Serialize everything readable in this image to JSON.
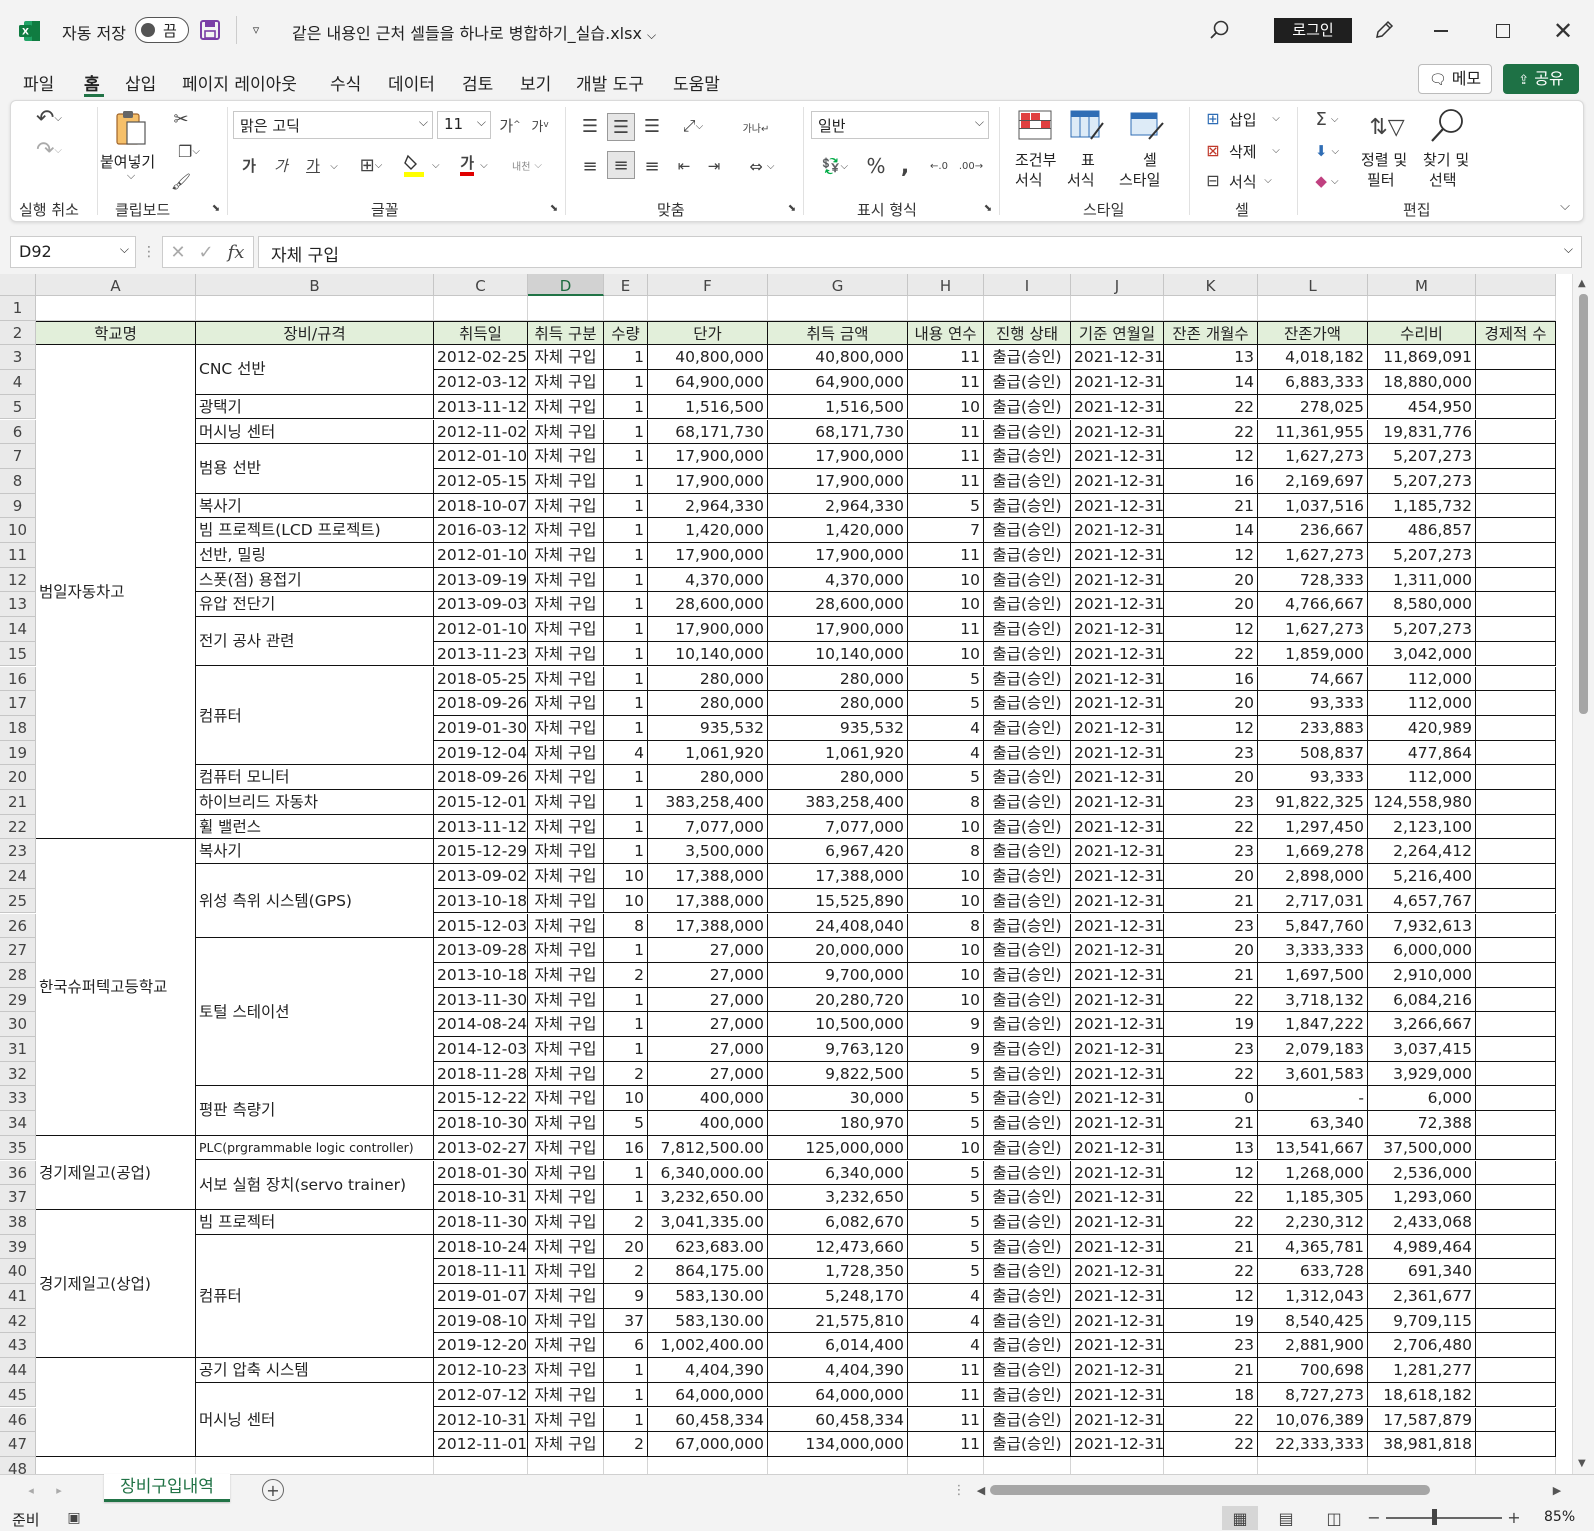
{
  "titlebar": {
    "autosave_label": "자동 저장",
    "autosave_state": "끔",
    "filename": "같은 내용인 근처 셀들을 하나로 병합하기_실습.xlsx",
    "login_label": "로그인",
    "minimize_icon": "minimize-icon",
    "maximize_icon": "maximize-icon",
    "close_icon": "close-icon"
  },
  "menu": {
    "items": [
      "파일",
      "홈",
      "삽입",
      "페이지 레이아웃",
      "수식",
      "데이터",
      "검토",
      "보기",
      "개발 도구",
      "도움말"
    ],
    "active": "홈",
    "memo_label": "메모",
    "share_label": "공유"
  },
  "ribbon": {
    "groups": {
      "undo": "실행 취소",
      "clipboard": "클립보드",
      "font": "글꼴",
      "align": "맞춤",
      "number": "표시 형식",
      "style": "스타일",
      "cells": "셀",
      "edit": "편집"
    },
    "paste_label": "붙여넣기",
    "font_name": "맑은 고딕",
    "font_size": "11",
    "number_format": "일반",
    "conditional_format": [
      "조건부",
      "서식"
    ],
    "table_format": [
      "표",
      "서식"
    ],
    "cell_style": [
      "셀",
      "스타일"
    ],
    "insert": "삽입",
    "delete": "삭제",
    "format": "서식",
    "sort_filter": [
      "정렬 및",
      "필터"
    ],
    "find_select": [
      "찾기 및",
      "선택"
    ],
    "wrap_text": "자동 줄 바꿈",
    "bold": "가",
    "italic": "가",
    "underline": "가",
    "font_color_glyph": "가"
  },
  "formula_bar": {
    "name_box": "D92",
    "fx": "fx",
    "value": "자체 구입"
  },
  "columns": [
    "A",
    "B",
    "C",
    "D",
    "E",
    "F",
    "G",
    "H",
    "I",
    "J",
    "K",
    "L",
    "M"
  ],
  "header_row": [
    "학교명",
    "장비/규격",
    "취득일",
    "취득 구분",
    "수량",
    "단가",
    "취득 금액",
    "내용 연수",
    "진행 상태",
    "기준 연월일",
    "잔존 개월수",
    "잔존가액",
    "수리비",
    "경제적 수"
  ],
  "merged_a": [
    {
      "text": "범일자동차고",
      "from": 3,
      "to": 22
    },
    {
      "text": "한국슈퍼텍고등학교",
      "from": 23,
      "to": 34
    },
    {
      "text": "경기제일고(공업)",
      "from": 35,
      "to": 37
    },
    {
      "text": "경기제일고(상업)",
      "from": 38,
      "to": 43
    },
    {
      "text": "",
      "from": 44,
      "to": 47
    }
  ],
  "merged_b": [
    {
      "text": "CNC 선반",
      "from": 3,
      "to": 4
    },
    {
      "text": "광택기",
      "from": 5,
      "to": 5
    },
    {
      "text": "머시닝 센터",
      "from": 6,
      "to": 6
    },
    {
      "text": "범용 선반",
      "from": 7,
      "to": 8
    },
    {
      "text": "복사기",
      "from": 9,
      "to": 9
    },
    {
      "text": "빔 프로젝트(LCD 프로젝트)",
      "from": 10,
      "to": 10
    },
    {
      "text": "선반, 밀링",
      "from": 11,
      "to": 11
    },
    {
      "text": "스폿(점) 용접기",
      "from": 12,
      "to": 12
    },
    {
      "text": "유압 전단기",
      "from": 13,
      "to": 13
    },
    {
      "text": "전기 공사 관련",
      "from": 14,
      "to": 15
    },
    {
      "text": "컴퓨터",
      "from": 16,
      "to": 19
    },
    {
      "text": "컴퓨터 모니터",
      "from": 20,
      "to": 20
    },
    {
      "text": "하이브리드 자동차",
      "from": 21,
      "to": 21
    },
    {
      "text": "휠 밸런스",
      "from": 22,
      "to": 22
    },
    {
      "text": "복사기",
      "from": 23,
      "to": 23
    },
    {
      "text": "위성 측위 시스템(GPS)",
      "from": 24,
      "to": 26
    },
    {
      "text": "토털 스테이션",
      "from": 27,
      "to": 32
    },
    {
      "text": "평판 측량기",
      "from": 33,
      "to": 34
    },
    {
      "text": "PLC(prgrammable logic controller)",
      "from": 35,
      "to": 35
    },
    {
      "text": "서보 실험 장치(servo trainer)",
      "from": 36,
      "to": 37
    },
    {
      "text": "빔 프로젝터",
      "from": 38,
      "to": 38
    },
    {
      "text": "컴퓨터",
      "from": 39,
      "to": 43
    },
    {
      "text": "공기 압축 시스템",
      "from": 44,
      "to": 44
    },
    {
      "text": "머시닝 센터",
      "from": 45,
      "to": 47
    }
  ],
  "rows": [
    [
      "2012-02-25",
      "자체 구입",
      "1",
      "40,800,000",
      "40,800,000",
      "11",
      "출급(승인)",
      "2021-12-31",
      "13",
      "4,018,182",
      "11,869,091"
    ],
    [
      "2012-03-12",
      "자체 구입",
      "1",
      "64,900,000",
      "64,900,000",
      "11",
      "출급(승인)",
      "2021-12-31",
      "14",
      "6,883,333",
      "18,880,000"
    ],
    [
      "2013-11-12",
      "자체 구입",
      "1",
      "1,516,500",
      "1,516,500",
      "10",
      "출급(승인)",
      "2021-12-31",
      "22",
      "278,025",
      "454,950"
    ],
    [
      "2012-11-02",
      "자체 구입",
      "1",
      "68,171,730",
      "68,171,730",
      "11",
      "출급(승인)",
      "2021-12-31",
      "22",
      "11,361,955",
      "19,831,776"
    ],
    [
      "2012-01-10",
      "자체 구입",
      "1",
      "17,900,000",
      "17,900,000",
      "11",
      "출급(승인)",
      "2021-12-31",
      "12",
      "1,627,273",
      "5,207,273"
    ],
    [
      "2012-05-15",
      "자체 구입",
      "1",
      "17,900,000",
      "17,900,000",
      "11",
      "출급(승인)",
      "2021-12-31",
      "16",
      "2,169,697",
      "5,207,273"
    ],
    [
      "2018-10-07",
      "자체 구입",
      "1",
      "2,964,330",
      "2,964,330",
      "5",
      "출급(승인)",
      "2021-12-31",
      "21",
      "1,037,516",
      "1,185,732"
    ],
    [
      "2016-03-12",
      "자체 구입",
      "1",
      "1,420,000",
      "1,420,000",
      "7",
      "출급(승인)",
      "2021-12-31",
      "14",
      "236,667",
      "486,857"
    ],
    [
      "2012-01-10",
      "자체 구입",
      "1",
      "17,900,000",
      "17,900,000",
      "11",
      "출급(승인)",
      "2021-12-31",
      "12",
      "1,627,273",
      "5,207,273"
    ],
    [
      "2013-09-19",
      "자체 구입",
      "1",
      "4,370,000",
      "4,370,000",
      "10",
      "출급(승인)",
      "2021-12-31",
      "20",
      "728,333",
      "1,311,000"
    ],
    [
      "2013-09-03",
      "자체 구입",
      "1",
      "28,600,000",
      "28,600,000",
      "10",
      "출급(승인)",
      "2021-12-31",
      "20",
      "4,766,667",
      "8,580,000"
    ],
    [
      "2012-01-10",
      "자체 구입",
      "1",
      "17,900,000",
      "17,900,000",
      "11",
      "출급(승인)",
      "2021-12-31",
      "12",
      "1,627,273",
      "5,207,273"
    ],
    [
      "2013-11-23",
      "자체 구입",
      "1",
      "10,140,000",
      "10,140,000",
      "10",
      "출급(승인)",
      "2021-12-31",
      "22",
      "1,859,000",
      "3,042,000"
    ],
    [
      "2018-05-25",
      "자체 구입",
      "1",
      "280,000",
      "280,000",
      "5",
      "출급(승인)",
      "2021-12-31",
      "16",
      "74,667",
      "112,000"
    ],
    [
      "2018-09-26",
      "자체 구입",
      "1",
      "280,000",
      "280,000",
      "5",
      "출급(승인)",
      "2021-12-31",
      "20",
      "93,333",
      "112,000"
    ],
    [
      "2019-01-30",
      "자체 구입",
      "1",
      "935,532",
      "935,532",
      "4",
      "출급(승인)",
      "2021-12-31",
      "12",
      "233,883",
      "420,989"
    ],
    [
      "2019-12-04",
      "자체  구입",
      "4",
      "1,061,920",
      "1,061,920",
      "4",
      "출급(승인)",
      "2021-12-31",
      "23",
      "508,837",
      "477,864"
    ],
    [
      "2018-09-26",
      "자체 구입",
      "1",
      "280,000",
      "280,000",
      "5",
      "출급(승인)",
      "2021-12-31",
      "20",
      "93,333",
      "112,000"
    ],
    [
      "2015-12-01",
      "자체 구입",
      "1",
      "383,258,400",
      "383,258,400",
      "8",
      "출급(승인)",
      "2021-12-31",
      "23",
      "91,822,325",
      "124,558,980"
    ],
    [
      "2013-11-12",
      "자체 구입",
      "1",
      "7,077,000",
      "7,077,000",
      "10",
      "출급(승인)",
      "2021-12-31",
      "22",
      "1,297,450",
      "2,123,100"
    ],
    [
      "2015-12-29",
      "자체 구입",
      "1",
      "3,500,000",
      "6,967,420",
      "8",
      "출급(승인)",
      "2021-12-31",
      "23",
      "1,669,278",
      "2,264,412"
    ],
    [
      "2013-09-02",
      "자체 구입",
      "10",
      "17,388,000",
      "17,388,000",
      "10",
      "출급(승인)",
      "2021-12-31",
      "20",
      "2,898,000",
      "5,216,400"
    ],
    [
      "2013-10-18",
      "자체 구입",
      "10",
      "17,388,000",
      "15,525,890",
      "10",
      "출급(승인)",
      "2021-12-31",
      "21",
      "2,717,031",
      "4,657,767"
    ],
    [
      "2015-12-03",
      "자체 구입",
      "8",
      "17,388,000",
      "24,408,040",
      "8",
      "출급(승인)",
      "2021-12-31",
      "23",
      "5,847,760",
      "7,932,613"
    ],
    [
      "2013-09-28",
      "자체 구입",
      "1",
      "27,000",
      "20,000,000",
      "10",
      "출급(승인)",
      "2021-12-31",
      "20",
      "3,333,333",
      "6,000,000"
    ],
    [
      "2013-10-18",
      "자체 구입",
      "2",
      "27,000",
      "9,700,000",
      "10",
      "출급(승인)",
      "2021-12-31",
      "21",
      "1,697,500",
      "2,910,000"
    ],
    [
      "2013-11-30",
      "자체 구입",
      "1",
      "27,000",
      "20,280,720",
      "10",
      "출급(승인)",
      "2021-12-31",
      "22",
      "3,718,132",
      "6,084,216"
    ],
    [
      "2014-08-24",
      "자체 구입",
      "1",
      "27,000",
      "10,500,000",
      "9",
      "출급(승인)",
      "2021-12-31",
      "19",
      "1,847,222",
      "3,266,667"
    ],
    [
      "2014-12-03",
      "자체 구입",
      "1",
      "27,000",
      "9,763,120",
      "9",
      "출급(승인)",
      "2021-12-31",
      "23",
      "2,079,183",
      "3,037,415"
    ],
    [
      "2018-11-28",
      "자체 구입",
      "2",
      "27,000",
      "9,822,500",
      "5",
      "출급(승인)",
      "2021-12-31",
      "22",
      "3,601,583",
      "3,929,000"
    ],
    [
      "2015-12-22",
      "자체 구입",
      "10",
      "400,000",
      "30,000",
      "5",
      "출급(승인)",
      "2021-12-31",
      "0",
      "-",
      "6,000"
    ],
    [
      "2018-10-30",
      "자체 구입",
      "5",
      "400,000",
      "180,970",
      "5",
      "출급(승인)",
      "2021-12-31",
      "21",
      "63,340",
      "72,388"
    ],
    [
      "2013-02-27",
      "자체 구입",
      "16",
      "7,812,500.00",
      "125,000,000",
      "10",
      "출급(승인)",
      "2021-12-31",
      "13",
      "13,541,667",
      "37,500,000"
    ],
    [
      "2018-01-30",
      "자체 구입",
      "1",
      "6,340,000.00",
      "6,340,000",
      "5",
      "출급(승인)",
      "2021-12-31",
      "12",
      "1,268,000",
      "2,536,000"
    ],
    [
      "2018-10-31",
      "자체 구입",
      "1",
      "3,232,650.00",
      "3,232,650",
      "5",
      "출급(승인)",
      "2021-12-31",
      "22",
      "1,185,305",
      "1,293,060"
    ],
    [
      "2018-11-30",
      "자체 구입",
      "2",
      "3,041,335.00",
      "6,082,670",
      "5",
      "출급(승인)",
      "2021-12-31",
      "22",
      "2,230,312",
      "2,433,068"
    ],
    [
      "2018-10-24",
      "자체 구입",
      "20",
      "623,683.00",
      "12,473,660",
      "5",
      "출급(승인)",
      "2021-12-31",
      "21",
      "4,365,781",
      "4,989,464"
    ],
    [
      "2018-11-11",
      "자체 구입",
      "2",
      "864,175.00",
      "1,728,350",
      "5",
      "출급(승인)",
      "2021-12-31",
      "22",
      "633,728",
      "691,340"
    ],
    [
      "2019-01-07",
      "자체 구입",
      "9",
      "583,130.00",
      "5,248,170",
      "4",
      "출급(승인)",
      "2021-12-31",
      "12",
      "1,312,043",
      "2,361,677"
    ],
    [
      "2019-08-10",
      "자체 구입",
      "37",
      "583,130.00",
      "21,575,810",
      "4",
      "출급(승인)",
      "2021-12-31",
      "19",
      "8,540,425",
      "9,709,115"
    ],
    [
      "2019-12-20",
      "자체 구입",
      "6",
      "1,002,400.00",
      "6,014,400",
      "4",
      "출급(승인)",
      "2021-12-31",
      "23",
      "2,881,900",
      "2,706,480"
    ],
    [
      "2012-10-23",
      "자체 구입",
      "1",
      "4,404,390",
      "4,404,390",
      "11",
      "출급(승인)",
      "2021-12-31",
      "21",
      "700,698",
      "1,281,277"
    ],
    [
      "2012-07-12",
      "자체 구입",
      "1",
      "64,000,000",
      "64,000,000",
      "11",
      "출급(승인)",
      "2021-12-31",
      "18",
      "8,727,273",
      "18,618,182"
    ],
    [
      "2012-10-31",
      "자체 구입",
      "1",
      "60,458,334",
      "60,458,334",
      "11",
      "출급(승인)",
      "2021-12-31",
      "22",
      "10,076,389",
      "17,587,879"
    ],
    [
      "2012-11-01",
      "자체 구입",
      "2",
      "67,000,000",
      "134,000,000",
      "11",
      "출급(승인)",
      "2021-12-31",
      "22",
      "22,333,333",
      "38,981,818"
    ]
  ],
  "sheet_tab": "장비구입내역",
  "status": {
    "ready": "준비",
    "zoom": "85%"
  },
  "colors": {
    "excel_green": "#217346",
    "header_fill": "#e2efda",
    "share_button": "#1e7145"
  }
}
